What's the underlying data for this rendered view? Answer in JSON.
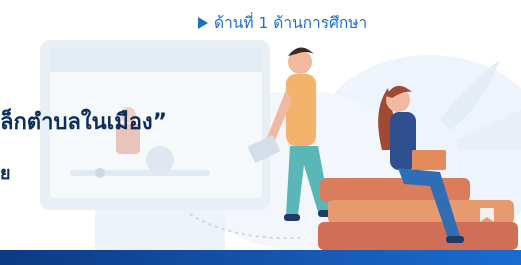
{
  "banner": {
    "category_label": "ด้านที่ 1 ด้านการศึกษา",
    "headline_visible": "ล็กตำบลในเมือง”",
    "subline_visible": "ย"
  },
  "colors": {
    "accent": "#1e6fc7",
    "headline": "#0d2d5f",
    "bar": "#1559b3"
  },
  "icons": [
    "play-triangle-icon"
  ]
}
